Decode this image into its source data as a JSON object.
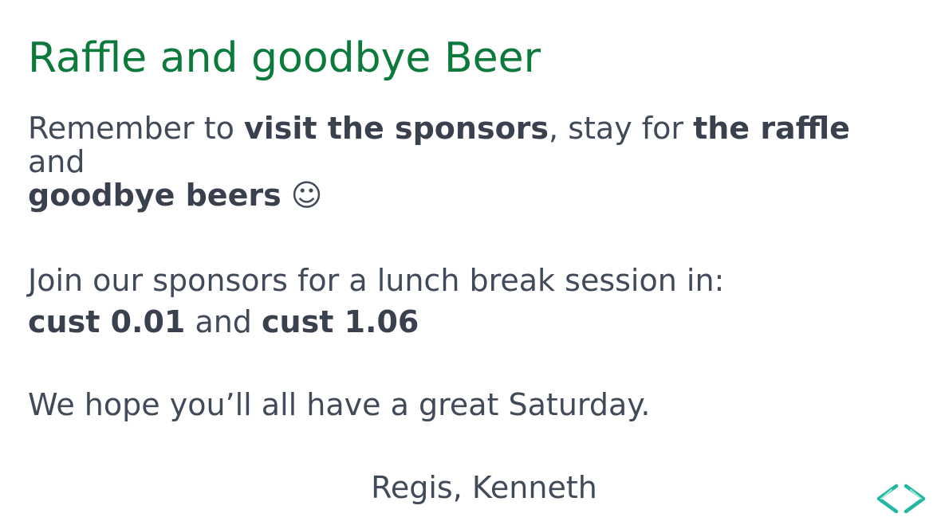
{
  "slide": {
    "title": "Raffle and goodbye Beer",
    "p1": {
      "t1": "Remember to ",
      "b1": "visit the sponsors",
      "t2": ", stay for ",
      "b2": "the raffle",
      "t3": " and ",
      "b3": "goodbye beers",
      "emoji": " ☺"
    },
    "p2": {
      "line1": "Join our sponsors for a lunch break session in:",
      "b1": "cust 0.01",
      "t1": " and ",
      "b2": "cust 1.06"
    },
    "p3": "We hope you’ll all have a great Saturday.",
    "signature": "Regis, Kenneth"
  },
  "nav": {
    "prev_icon": "chevron-left-icon",
    "next_icon": "chevron-right-icon",
    "color": "#21b7a0"
  }
}
